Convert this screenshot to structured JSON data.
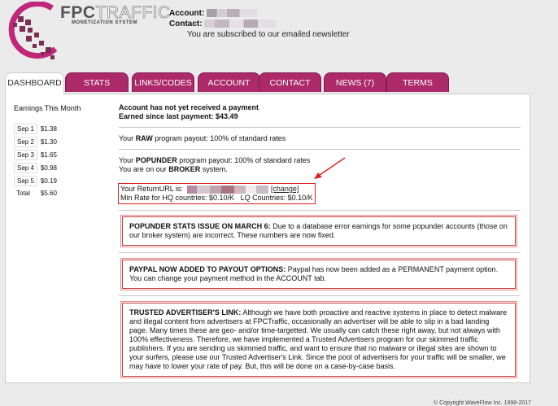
{
  "brand": {
    "name_bold": "FPC",
    "name_light": "TRAFFIC",
    "subtitle": "MONETIZATION SYSTEM",
    "accent": "#ad2a6a"
  },
  "account": {
    "account_label": "Account:",
    "contact_label": "Contact:",
    "newsletter": "You are subscribed to our emailed newsletter"
  },
  "tabs": [
    {
      "label": "DASHBOARD"
    },
    {
      "label": "STATS"
    },
    {
      "label": "LINKS/CODES"
    },
    {
      "label": "ACCOUNT"
    },
    {
      "label": "CONTACT"
    },
    {
      "label": "NEWS (7)"
    },
    {
      "label": "TERMS"
    }
  ],
  "earnings": {
    "title": "Earnings This Month",
    "rows": [
      {
        "day": "Sep 1",
        "value": "$1.38"
      },
      {
        "day": "Sep 2",
        "value": "$1.30"
      },
      {
        "day": "Sep 3",
        "value": "$1.65"
      },
      {
        "day": "Sep 4",
        "value": "$0.98"
      },
      {
        "day": "Sep 5",
        "value": "$0.19"
      },
      {
        "day": "Total",
        "value": "$5.60"
      }
    ]
  },
  "payment": {
    "line1": "Account has not yet received a payment",
    "line2": "Earned since last payment: $43.49"
  },
  "raw": {
    "pre": "Your ",
    "bold": "RAW",
    "post": " program payout: 100% of standard rates"
  },
  "popunder": {
    "pre": "Your ",
    "bold": "POPUNDER",
    "post": " program payout: 100% of standard rates",
    "broker_pre": "You are on our ",
    "broker_bold": "BROKER",
    "broker_post": " system."
  },
  "return_url": {
    "label": "Your ReturnURL is:",
    "change": "[change]",
    "min_rate": "Min Rate for HQ countries: $0.10/K   LQ Countries: $0.10/K"
  },
  "notices": [
    {
      "title": "POPUNDER STATS ISSUE ON MARCH 6:",
      "body": " Due to a database error earnings for some popunder accounts (those on our broker system) are incorrect. These numbers are now fixed."
    },
    {
      "title": "PAYPAL NOW ADDED TO PAYOUT OPTIONS:",
      "body": " Paypal has now been added as a PERMANENT payment option. You can change your payment method in the ACCOUNT tab."
    },
    {
      "title": "TRUSTED ADVERTISER'S LINK:",
      "body": " Although we have both proactive and reactive systems in place to detect malware and illegal content from advertisers at FPCTraffic, occasionally an advertiser will be able to slip in a bad landing page. Many times these are geo- and/or time-targetted. We usually can catch these right away, but not always with 100% effectiveness. Therefore, we have implemented a Trusted Advertisers program for our skimmed traffic publishers. If you are sending us skimmed traffic, and want to ensure that no malware or illegal sites are shown to your surfers, please use our Trusted Advertiser's Link. Since the pool of advertisers for your traffic will be smaller, we may have to lower your rate of pay. But, this will be done on a case-by-case basis."
    }
  ],
  "footer": "© Copyright WaveFlow Inc. 1998-2017"
}
